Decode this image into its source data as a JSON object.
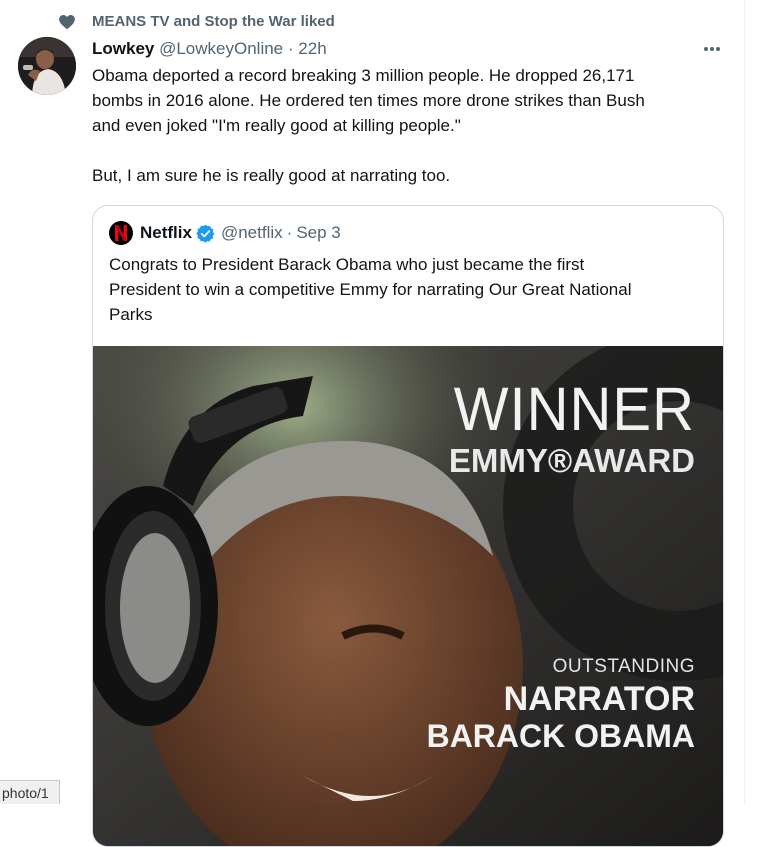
{
  "social_context": {
    "text": "MEANS TV and Stop the War liked",
    "icon": "heart-icon"
  },
  "tweet": {
    "name": "Lowkey",
    "handle": "@LowkeyOnline",
    "separator": "·",
    "time": "22h",
    "lines": [
      "Obama deported a record breaking 3 million people. He dropped 26,171",
      "bombs in 2016 alone. He ordered ten times more drone strikes than Bush",
      "and even joked \"I'm really good at killing people.\"",
      "But, I am sure he is really good at narrating too."
    ]
  },
  "quoted": {
    "name": "Netflix",
    "handle": "@netflix",
    "separator": "·",
    "date": "Sep 3",
    "lines": [
      "Congrats to President Barack Obama who just became the first",
      "President to win a competitive Emmy for narrating Our Great National",
      "Parks"
    ],
    "media": {
      "winner": "WINNER",
      "emmy": "EMMY®AWARD",
      "outstanding": "OUTSTANDING",
      "narrator": "NARRATOR",
      "name": "BARACK OBAMA"
    }
  },
  "status_url_fragment": "photo/1",
  "colors": {
    "text": "#0f1419",
    "secondary": "#536471",
    "verified": "#1d9bf0",
    "border": "#cfd9de"
  }
}
